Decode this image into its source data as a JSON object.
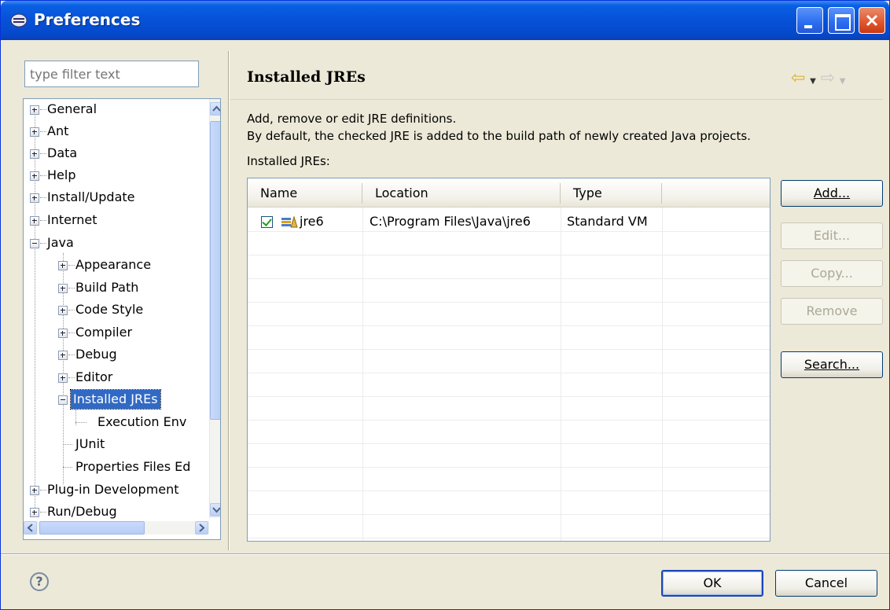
{
  "window": {
    "title": "Preferences"
  },
  "filter": {
    "placeholder": "type filter text"
  },
  "tree": {
    "items": [
      {
        "label": "General"
      },
      {
        "label": "Ant"
      },
      {
        "label": "Data"
      },
      {
        "label": "Help"
      },
      {
        "label": "Install/Update"
      },
      {
        "label": "Internet"
      },
      {
        "label": "Java"
      },
      {
        "label": "Appearance"
      },
      {
        "label": "Build Path"
      },
      {
        "label": "Code Style"
      },
      {
        "label": "Compiler"
      },
      {
        "label": "Debug"
      },
      {
        "label": "Editor"
      },
      {
        "label": "Installed JREs"
      },
      {
        "label": "Execution Env"
      },
      {
        "label": "JUnit"
      },
      {
        "label": "Properties Files Ed"
      },
      {
        "label": "Plug-in Development"
      },
      {
        "label": "Run/Debug"
      }
    ]
  },
  "page": {
    "title": "Installed JREs",
    "desc_line1": "Add, remove or edit JRE definitions.",
    "desc_line2": "By default, the checked JRE is added to the build path of newly created Java projects.",
    "table_label": "Installed JREs:"
  },
  "table": {
    "columns": [
      "Name",
      "Location",
      "Type"
    ],
    "rows": [
      {
        "checked": true,
        "name": "jre6",
        "location": "C:\\Program Files\\Java\\jre6",
        "type": "Standard VM"
      }
    ]
  },
  "buttons": {
    "add": "Add...",
    "edit": "Edit...",
    "copy": "Copy...",
    "remove": "Remove",
    "search": "Search...",
    "ok": "OK",
    "cancel": "Cancel"
  },
  "help": {
    "glyph": "?"
  },
  "colors": {
    "selection": "#316ac5",
    "titlebar": "#0651d6",
    "dialog_bg": "#ece9d8"
  }
}
